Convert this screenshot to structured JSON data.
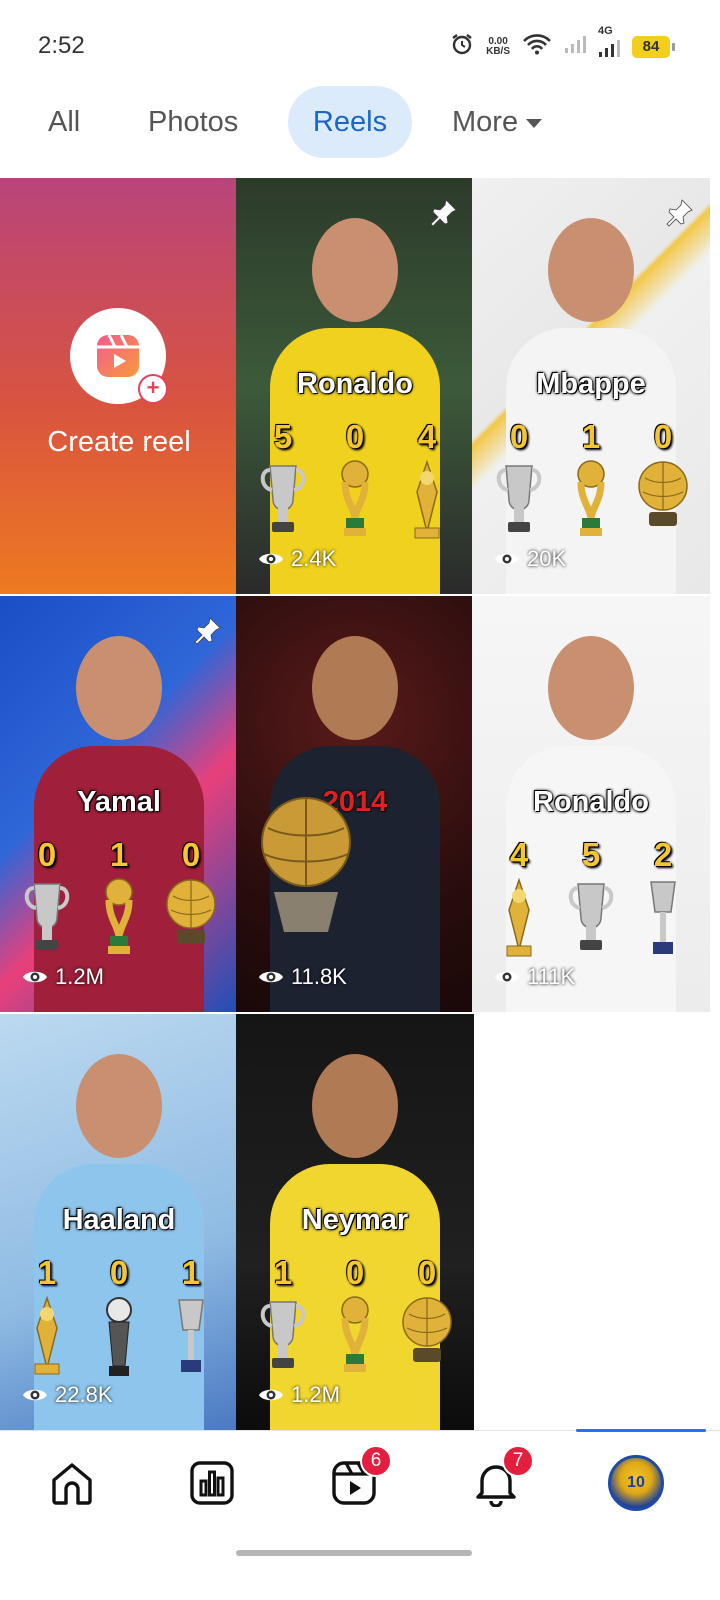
{
  "status_bar": {
    "time": "2:52",
    "net_speed_value": "0.00",
    "net_speed_unit": "KB/S",
    "network": "4G",
    "battery": "84"
  },
  "tabs": [
    {
      "label": "All",
      "active": false
    },
    {
      "label": "Photos",
      "active": false
    },
    {
      "label": "Reels",
      "active": true
    },
    {
      "label": "More",
      "active": false
    }
  ],
  "create_reel": {
    "label": "Create reel"
  },
  "reels": [
    {
      "name": "Ronaldo",
      "counts": [
        "5",
        "0",
        "4"
      ],
      "trophies": [
        "champions-league-trophy",
        "world-cup-trophy",
        "club-world-cup-trophy"
      ],
      "views": "2.4K",
      "pinned": true,
      "jersey_color": "#f0d21e"
    },
    {
      "name": "Mbappe",
      "counts": [
        "0",
        "1",
        "0"
      ],
      "trophies": [
        "champions-league-trophy",
        "world-cup-trophy",
        "ballon-dor-trophy"
      ],
      "views": "20K",
      "pinned": true,
      "jersey_color": "#f4f4f4"
    },
    {
      "name": "Yamal",
      "counts": [
        "0",
        "1",
        "0"
      ],
      "trophies": [
        "champions-league-trophy",
        "world-cup-trophy",
        "ballon-dor-trophy"
      ],
      "views": "1.2M",
      "pinned": true,
      "jersey_color": "#a01f3a"
    },
    {
      "name": "2014",
      "counts": [],
      "trophies": [
        "ballon-dor-trophy"
      ],
      "views": "11.8K",
      "pinned": false,
      "jersey_color": "#1c2230"
    },
    {
      "name": "Ronaldo",
      "counts": [
        "4",
        "5",
        "2"
      ],
      "trophies": [
        "club-world-cup-trophy",
        "champions-league-trophy",
        "super-cup-trophy"
      ],
      "views": "111K",
      "pinned": false,
      "jersey_color": "#f6f6f6"
    },
    {
      "name": "Haaland",
      "counts": [
        "1",
        "0",
        "1"
      ],
      "trophies": [
        "club-world-cup-trophy",
        "fifa-best-trophy",
        "super-cup-trophy"
      ],
      "views": "22.8K",
      "pinned": false,
      "jersey_color": "#8ec5ec"
    },
    {
      "name": "Neymar",
      "counts": [
        "1",
        "0",
        "0"
      ],
      "trophies": [
        "champions-league-trophy",
        "world-cup-trophy",
        "ballon-dor-trophy"
      ],
      "views": "1.2M",
      "pinned": false,
      "jersey_color": "#f2d630"
    }
  ],
  "bottom_nav": {
    "reels_badge": "6",
    "notifications_badge": "7",
    "avatar_text": "10"
  },
  "colors": {
    "accent": "#1877f2",
    "active_tab_bg": "#dcebfc",
    "active_tab_text": "#1a66c9",
    "badge": "#e41e3f",
    "trophy_number": "#f4c630"
  }
}
